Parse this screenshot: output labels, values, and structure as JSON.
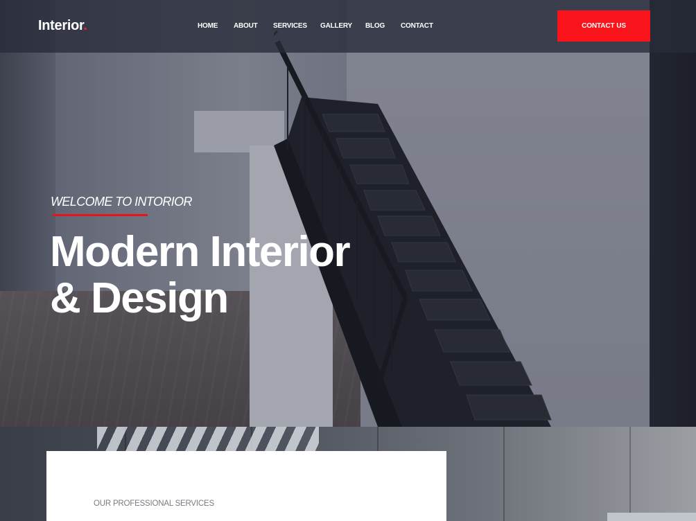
{
  "brand": {
    "name": "Interior",
    "dot": ".",
    "accent_color": "#ff1e1e"
  },
  "nav": {
    "items": [
      {
        "label": "HOME"
      },
      {
        "label": "ABOUT"
      },
      {
        "label": "SERVICES"
      },
      {
        "label": "GALLERY"
      },
      {
        "label": "BLOG"
      },
      {
        "label": "CONTACT"
      }
    ],
    "cta_label": "CONTACT US"
  },
  "hero": {
    "welcome": "WELCOME TO INTORIOR",
    "headline_line1": "Modern Interior",
    "headline_line2": "& Design"
  },
  "services": {
    "eyebrow": "OUR PROFESSIONAL SERVICES"
  }
}
